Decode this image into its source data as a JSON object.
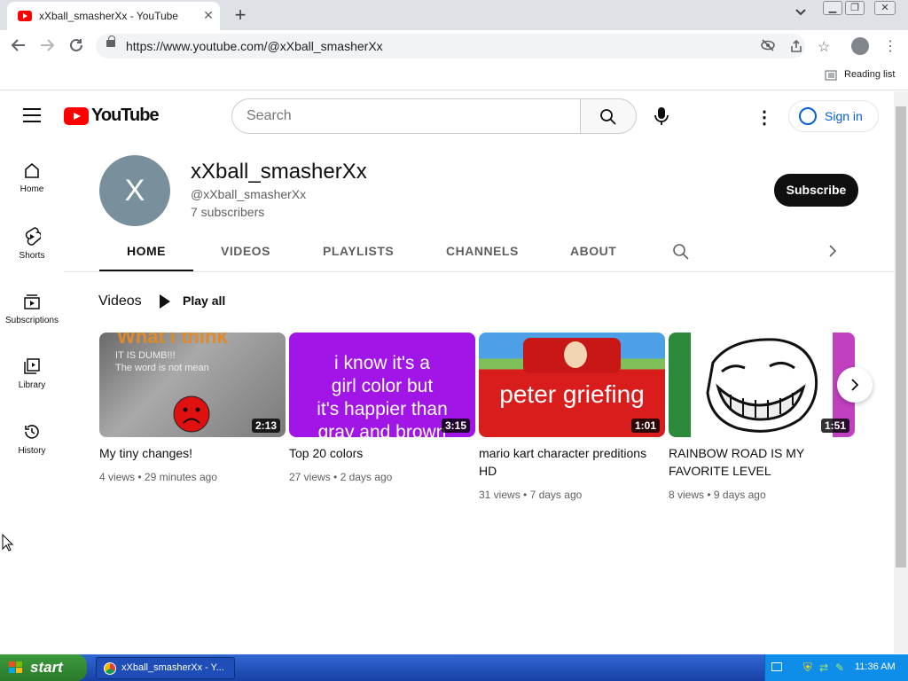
{
  "browser": {
    "tab_title": "xXball_smasherXx - YouTube",
    "tab_close": "✕",
    "new_tab": "+",
    "url": "https://www.youtube.com/@xXball_smasherXx",
    "reading_list": "Reading list"
  },
  "header": {
    "logo_text": "YouTube",
    "search_placeholder": "Search",
    "signin": "Sign in"
  },
  "sidebar": {
    "items": [
      {
        "label": "Home"
      },
      {
        "label": "Shorts"
      },
      {
        "label": "Subscriptions"
      },
      {
        "label": "Library"
      },
      {
        "label": "History"
      }
    ]
  },
  "channel": {
    "avatar_letter": "X",
    "name": "xXball_smasherXx",
    "handle": "@xXball_smasherXx",
    "subscribers": "7 subscribers",
    "subscribe": "Subscribe",
    "tabs": [
      "HOME",
      "VIDEOS",
      "PLAYLISTS",
      "CHANNELS",
      "ABOUT"
    ]
  },
  "videos_section": {
    "heading": "Videos",
    "play_all": "Play all",
    "videos": [
      {
        "title": "My tiny changes!",
        "views": "4 views",
        "age": "29 minutes ago",
        "duration": "2:13",
        "thumb_lines": [
          "What I think",
          "IT IS DUMB!!!",
          "The word is not mean"
        ]
      },
      {
        "title": "Top 20 colors",
        "views": "27 views",
        "age": "2 days ago",
        "duration": "3:15",
        "thumb_lines": [
          "i know it's a",
          "girl color but",
          "it's happier than",
          "gray and brown"
        ]
      },
      {
        "title": "mario kart character preditions HD",
        "views": "31 views",
        "age": "7 days ago",
        "duration": "1:01",
        "thumb_lines": [
          "peter griefing"
        ]
      },
      {
        "title": "RAINBOW ROAD IS MY FAVORITE LEVEL",
        "views": "8 views",
        "age": "9 days ago",
        "duration": "1:51",
        "thumb_lines": []
      }
    ],
    "meta_separator": "•"
  },
  "taskbar": {
    "start": "start",
    "task_item": "xXball_smasherXx - Y...",
    "clock": "11:36 AM"
  },
  "colors": {
    "youtube_red": "#ff0000",
    "link_blue": "#065fd4",
    "xp_blue": "#245edb",
    "xp_green": "#3c9a3c"
  }
}
